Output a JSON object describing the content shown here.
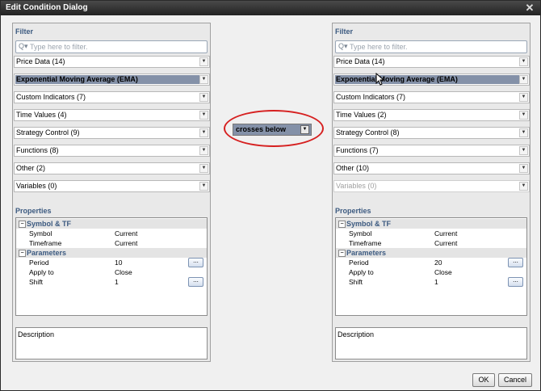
{
  "window": {
    "title": "Edit Condition Dialog"
  },
  "left": {
    "filter_title": "Filter",
    "filter_placeholder": "Type here to filter.",
    "dropdowns": [
      "Price Data (14)",
      "Exponential Moving Average (EMA)",
      "Custom Indicators (7)",
      "Time Values (4)",
      "Strategy Control (9)",
      "Functions (8)",
      "Other (2)",
      "Variables (0)"
    ],
    "properties_title": "Properties",
    "symbol_group": "Symbol & TF",
    "symbol_label": "Symbol",
    "symbol_value": "Current",
    "timeframe_label": "Timeframe",
    "timeframe_value": "Current",
    "params_group": "Parameters",
    "period_label": "Period",
    "period_value": "10",
    "apply_label": "Apply to",
    "apply_value": "Close",
    "shift_label": "Shift",
    "shift_value": "1",
    "description_label": "Description"
  },
  "right": {
    "filter_title": "Filter",
    "filter_placeholder": "Type here to filter.",
    "dropdowns": [
      "Price Data (14)",
      "Exponential Moving Average (EMA)",
      "Custom Indicators (7)",
      "Time Values (2)",
      "Strategy Control (8)",
      "Functions (7)",
      "Other (10)",
      "Variables (0)"
    ],
    "properties_title": "Properties",
    "symbol_group": "Symbol & TF",
    "symbol_label": "Symbol",
    "symbol_value": "Current",
    "timeframe_label": "Timeframe",
    "timeframe_value": "Current",
    "params_group": "Parameters",
    "period_label": "Period",
    "period_value": "20",
    "apply_label": "Apply to",
    "apply_value": "Close",
    "shift_label": "Shift",
    "shift_value": "1",
    "description_label": "Description"
  },
  "operator": {
    "value": "crosses below"
  },
  "buttons": {
    "ok": "OK",
    "cancel": "Cancel",
    "ellipsis": "..."
  },
  "icons": {
    "close": "close-icon",
    "search": "search-icon",
    "dropdown": "chevron-down-icon"
  },
  "colors": {
    "highlight": "#8491a8",
    "annotation": "#d62020",
    "section_title": "#3c5a80"
  }
}
